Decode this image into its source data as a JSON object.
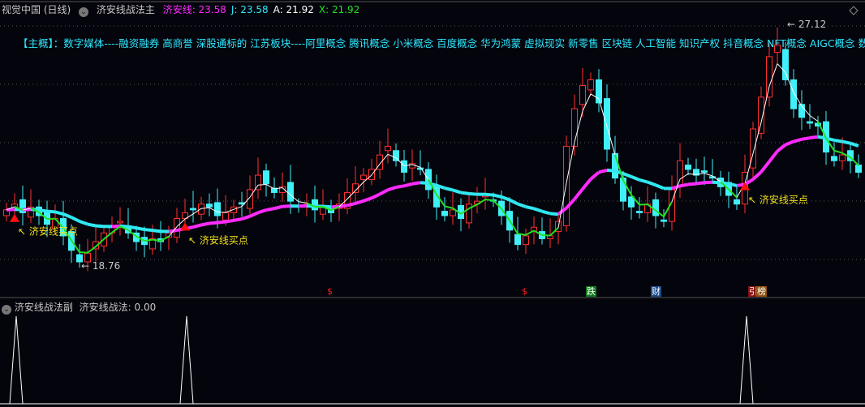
{
  "header": {
    "title": "视觉中国 (日线)",
    "indicator_name": "济安线战法主",
    "values": [
      {
        "label": "济安线:",
        "value": "23.58",
        "color": "#ff2bff"
      },
      {
        "label": "J:",
        "value": "23.58",
        "color": "#2ee8ff"
      },
      {
        "label": "A:",
        "value": "21.92",
        "color": "#ffffff"
      },
      {
        "label": "X:",
        "value": "21.92",
        "color": "#22e022"
      }
    ]
  },
  "concepts": "【主概】：数字媒体----融资融券 高商誉 深股通标的 江苏板块----阿里概念 腾讯概念 小米概念 百度概念 华为鸿蒙 虚拟现实 新零售 区块链 人工智能 知识产权 抖音概念 NFT概念 AIGC概念 数据确权",
  "annotations": {
    "high_label": "27.12",
    "low_label": "18.76",
    "buy_label": "济安线买点"
  },
  "events": [
    {
      "text": "$",
      "color": "#ff2020",
      "bg": ""
    },
    {
      "text": "$",
      "color": "#ff2020",
      "bg": ""
    },
    {
      "text": "跌",
      "color": "#ffffff",
      "bg": "#0e7a1a"
    },
    {
      "text": "财",
      "color": "#ffffff",
      "bg": "#174a8a"
    },
    {
      "text": "引",
      "color": "#ffffff",
      "bg": "#8a1010"
    },
    {
      "text": "榜",
      "color": "#ffffff",
      "bg": "#8a5010"
    }
  ],
  "sub_panel": {
    "name": "济安线战法副",
    "value_label": "济安线战法:",
    "value": "0.00"
  },
  "colors": {
    "up": "#ff3030",
    "down": "#40f0f8",
    "rising_line": "#ff2bff",
    "falling_line": "#30e8f0",
    "fast_above": "#ffffff",
    "fast_below": "#22e022"
  },
  "chart_data": {
    "type": "candlestick",
    "ylim": [
      18.76,
      27.12
    ],
    "closes": [
      20.7,
      20.9,
      20.6,
      20.8,
      20.5,
      20.2,
      20.4,
      19.8,
      19.3,
      18.9,
      19.2,
      19.6,
      19.9,
      20.1,
      20.3,
      19.9,
      19.6,
      19.5,
      19.7,
      19.6,
      19.9,
      20.4,
      20.6,
      20.7,
      20.9,
      20.8,
      20.5,
      20.6,
      20.8,
      20.9,
      21.4,
      21.9,
      21.6,
      21.3,
      21.5,
      21.0,
      20.8,
      20.9,
      20.7,
      20.8,
      20.6,
      20.9,
      21.3,
      21.6,
      21.9,
      22.1,
      22.6,
      22.9,
      22.4,
      22.0,
      22.3,
      22.1,
      21.4,
      20.8,
      20.5,
      20.7,
      20.4,
      20.9,
      21.0,
      21.2,
      21.0,
      20.5,
      20.0,
      19.5,
      19.8,
      20.1,
      19.7,
      19.8,
      20.3,
      22.9,
      24.2,
      25.0,
      25.2,
      24.4,
      22.8,
      21.8,
      21.0,
      20.8,
      20.6,
      20.9,
      20.5,
      20.3,
      21.4,
      22.4,
      22.1,
      21.9,
      22.0,
      21.8,
      21.5,
      21.2,
      20.9,
      22.0,
      23.5,
      24.6,
      26.0,
      26.4,
      25.2,
      24.2,
      23.9,
      23.7,
      23.6,
      22.7,
      22.4,
      22.6,
      22.4,
      22.0
    ],
    "buy_signal_indices": [
      1,
      22,
      91
    ],
    "event_indices": [
      40,
      64,
      72,
      80,
      92,
      93
    ],
    "sub_signal_values": [
      1,
      1,
      1
    ]
  }
}
